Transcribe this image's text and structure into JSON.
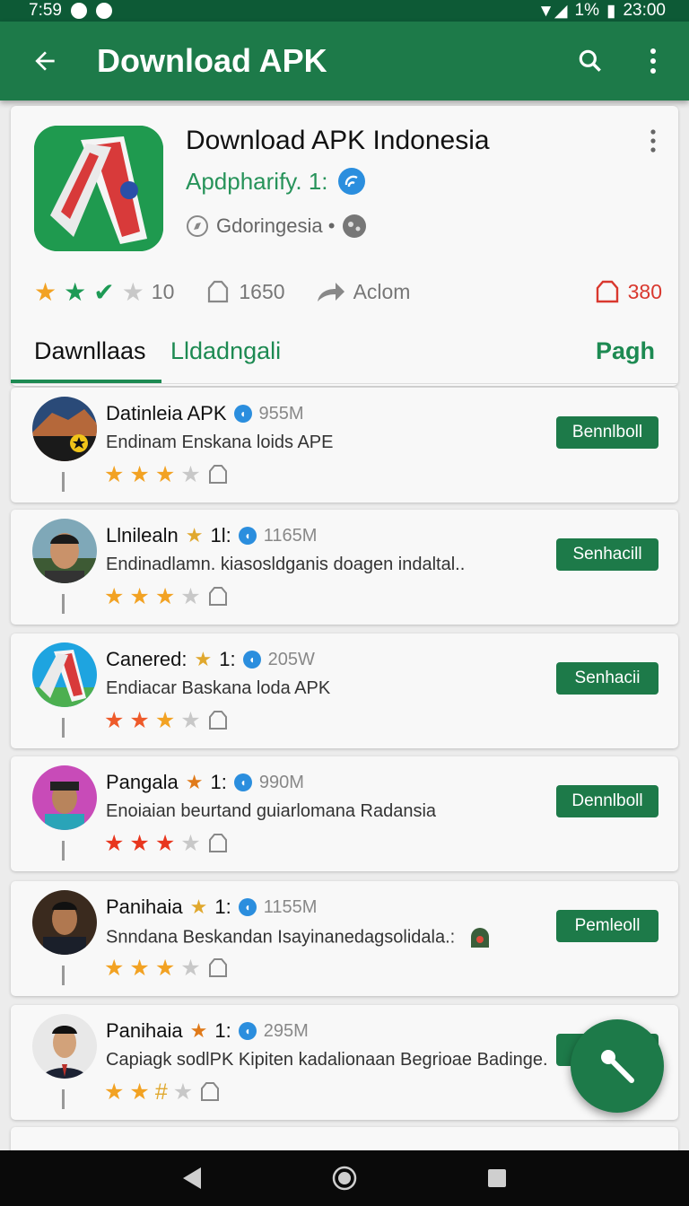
{
  "status_bar": {
    "time": "7:59",
    "battery": "1%",
    "clock": "23:00"
  },
  "app_bar": {
    "title": "Download APK"
  },
  "hero": {
    "title": "Download APK Indonesia",
    "developer": "Apdpharify. 1:",
    "category": "Gdoringesia •",
    "stats": {
      "rating": "10",
      "downloads": "1650",
      "share_label": "Aclom",
      "reports": "380"
    }
  },
  "tabs": [
    {
      "label": "Dawnllaas"
    },
    {
      "label": "Lldadngali"
    },
    {
      "label": "Pagh"
    }
  ],
  "items": [
    {
      "name": "Datinleia APK",
      "size": "955M",
      "desc": "Endinam Enskana loids APE",
      "button": "Bennlboll"
    },
    {
      "name": "Llnilealn",
      "badge": "1l:",
      "size": "1165M",
      "desc": "Endinadlamn. kiasosldganis doagen indaltal..",
      "button": "Senhacill"
    },
    {
      "name": "Canered:",
      "badge": "1:",
      "size": "205W",
      "desc": "Endiacar Baskana loda APK",
      "button": "Senhacii"
    },
    {
      "name": "Pangala",
      "badge": "1:",
      "size": "990M",
      "desc": "Enoiaian beurtand guiarlomana Radansia",
      "button": "Dennlboll"
    },
    {
      "name": "Panihaia",
      "badge": "1:",
      "size": "1155M",
      "desc": "Snndana Beskandan Isayinanedagsolidala.:",
      "button": "Pemleoll"
    },
    {
      "name": "Panihaia",
      "badge": "1:",
      "size": "295M",
      "desc": "Caрiagk sodlPK Kipiten kadalionaan Begrioae Badinge.",
      "button": ""
    }
  ],
  "colors": {
    "primary": "#1d7a49",
    "status": "#0d5a36",
    "accent": "#1d8a52",
    "warn": "#d9382e",
    "star": "#f2a223"
  },
  "icons": [
    "back-arrow-icon",
    "search-icon",
    "more-vert-icon",
    "verified-icon",
    "star-icon",
    "bookmark-icon",
    "share-icon",
    "flag-icon",
    "fab-search-icon"
  ]
}
